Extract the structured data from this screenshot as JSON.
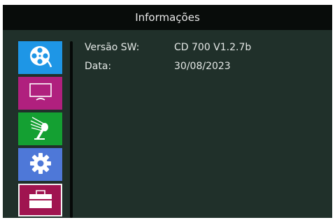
{
  "header": {
    "title": "Informações"
  },
  "sidebar": {
    "items": [
      {
        "icon": "film-reel-icon",
        "color": "#1e96e6",
        "selected": false
      },
      {
        "icon": "monitor-icon",
        "color": "#b0207e",
        "selected": false
      },
      {
        "icon": "spray-icon",
        "color": "#14a032",
        "selected": false
      },
      {
        "icon": "gear-icon",
        "color": "#4e78d8",
        "selected": false
      },
      {
        "icon": "toolbox-icon",
        "color": "#a01450",
        "selected": true
      }
    ]
  },
  "info": {
    "rows": [
      {
        "label": "Versão SW:",
        "value": "CD 700 V1.2.7b"
      },
      {
        "label": "Data:",
        "value": "30/08/2023"
      }
    ]
  },
  "colors": {
    "background": "#20302a",
    "title_bar": "#080c0a",
    "text": "#e4e8e6"
  }
}
